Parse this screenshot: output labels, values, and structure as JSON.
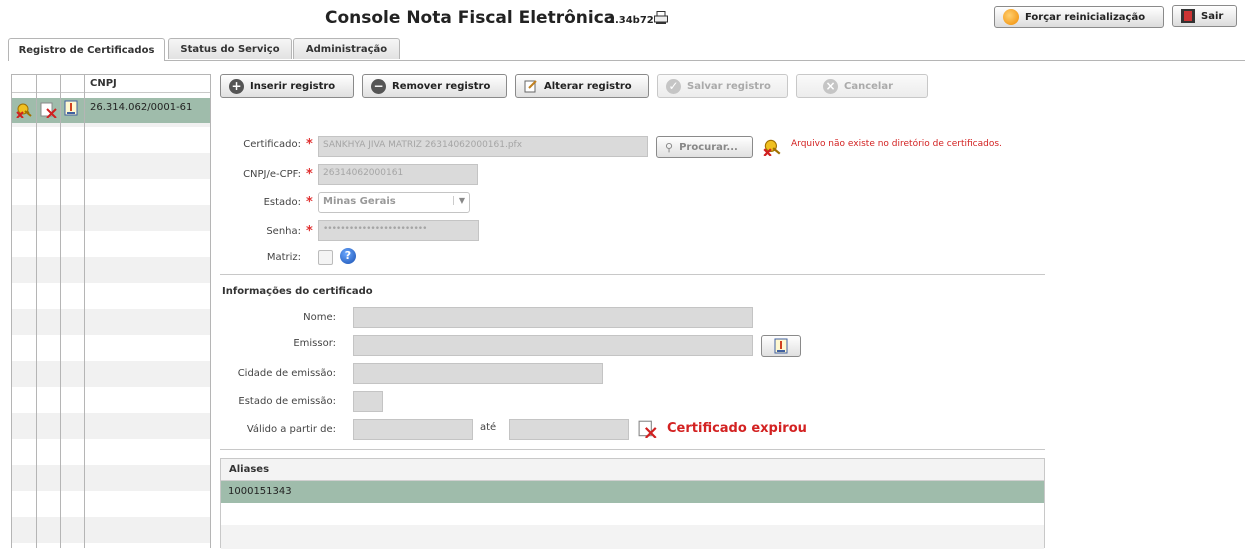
{
  "header": {
    "title": "Console Nota Fiscal Eletrônica",
    "version": "2.34b72",
    "restart_label": "Forçar reinicialização",
    "exit_label": "Sair"
  },
  "tabs": [
    {
      "label": "Registro de Certificados",
      "active": true
    },
    {
      "label": "Status do Serviço",
      "active": false
    },
    {
      "label": "Administração",
      "active": false
    }
  ],
  "grid": {
    "column_header": "CNPJ",
    "rows": [
      {
        "cnpj": "26.314.062/0001-61",
        "selected": true
      }
    ]
  },
  "toolbar": {
    "insert": "Inserir registro",
    "remove": "Remover registro",
    "edit": "Alterar registro",
    "save": "Salvar registro",
    "cancel": "Cancelar"
  },
  "form": {
    "certificate_label": "Certificado:",
    "certificate_value": "SANKHYA JIVA MATRIZ 26314062000161.pfx",
    "browse_label": "Procurar...",
    "certificate_error": "Arquivo não existe no diretório de certificados.",
    "cnpj_label": "CNPJ/e-CPF:",
    "cnpj_value": "26314062000161",
    "state_label": "Estado:",
    "state_value": "Minas Gerais",
    "password_label": "Senha:",
    "password_value": "••••••••••••••••••••••••",
    "matrix_label": "Matriz:",
    "required_mark": "*"
  },
  "cert_info": {
    "section_title": "Informações do certificado",
    "name_label": "Nome:",
    "issuer_label": "Emissor:",
    "city_label": "Cidade de emissão:",
    "state_label": "Estado de emissão:",
    "valid_from_label": "Válido a partir de:",
    "until_label": "até",
    "expired_message": "Certificado expirou"
  },
  "aliases": {
    "header": "Aliases",
    "rows": [
      "1000151343"
    ]
  },
  "colors": {
    "selected_row": "#9fbcab",
    "error_red": "#d32222",
    "field_bg": "#dadada"
  }
}
